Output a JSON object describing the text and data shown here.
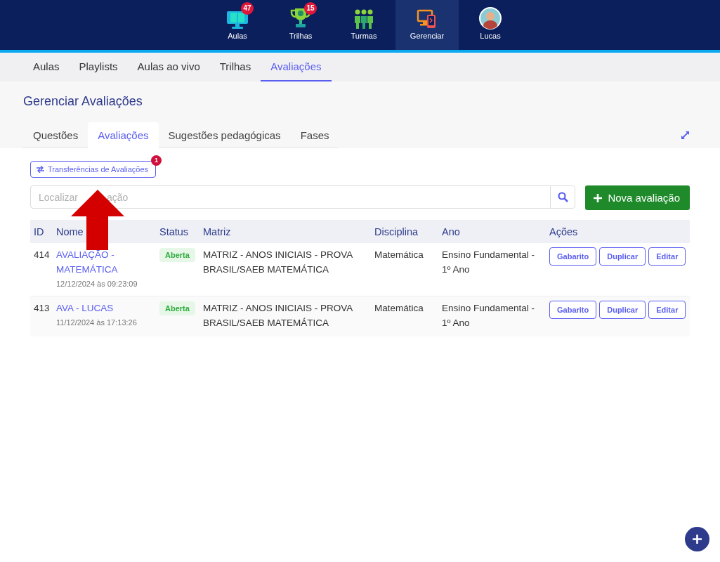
{
  "top_nav": [
    {
      "label": "Aulas",
      "badge": "47",
      "selected": false
    },
    {
      "label": "Trilhas",
      "badge": "15",
      "selected": false
    },
    {
      "label": "Turmas",
      "selected": false
    },
    {
      "label": "Gerenciar",
      "selected": true
    },
    {
      "label": "Lucas",
      "selected": false
    }
  ],
  "sub_nav": [
    {
      "label": "Aulas",
      "selected": false
    },
    {
      "label": "Playlists",
      "selected": false
    },
    {
      "label": "Aulas ao vivo",
      "selected": false
    },
    {
      "label": "Trilhas",
      "selected": false
    },
    {
      "label": "Avaliações",
      "selected": true
    }
  ],
  "page_title": "Gerenciar Avaliações",
  "tabs": [
    {
      "label": "Questões",
      "selected": false
    },
    {
      "label": "Avaliações",
      "selected": true
    },
    {
      "label": "Sugestões pedagógicas",
      "selected": false
    },
    {
      "label": "Fases",
      "selected": false
    }
  ],
  "transfer_button": {
    "label": "Transferências de Avaliações",
    "badge": "1"
  },
  "search": {
    "placeholder": [
      "Localizar",
      "ação"
    ]
  },
  "new_button": {
    "label": "Nova avaliação"
  },
  "table": {
    "columns": [
      "ID",
      "Nome",
      "Status",
      "Matriz",
      "Disciplina",
      "Ano",
      "Ações"
    ],
    "rows": [
      {
        "id": "414",
        "name": "AVALIAÇÃO - MATEMÁTICA",
        "date": "12/12/2024 às 09:23:09",
        "status": "Aberta",
        "matriz": "MATRIZ - ANOS INICIAIS - PROVA BRASIL/SAEB MATEMÁTICA",
        "disciplina": "Matemática",
        "ano": "Ensino Fundamental - 1º Ano",
        "actions": [
          "Gabarito",
          "Duplicar",
          "Editar"
        ]
      },
      {
        "id": "413",
        "name": "AVA - LUCAS",
        "date": "11/12/2024 às 17:13:26",
        "status": "Aberta",
        "matriz": "MATRIZ - ANOS INICIAIS - PROVA BRASIL/SAEB MATEMÁTICA",
        "disciplina": "Matemática",
        "ano": "Ensino Fundamental - 1º Ano",
        "actions": [
          "Gabarito",
          "Duplicar",
          "Editar"
        ]
      }
    ]
  }
}
